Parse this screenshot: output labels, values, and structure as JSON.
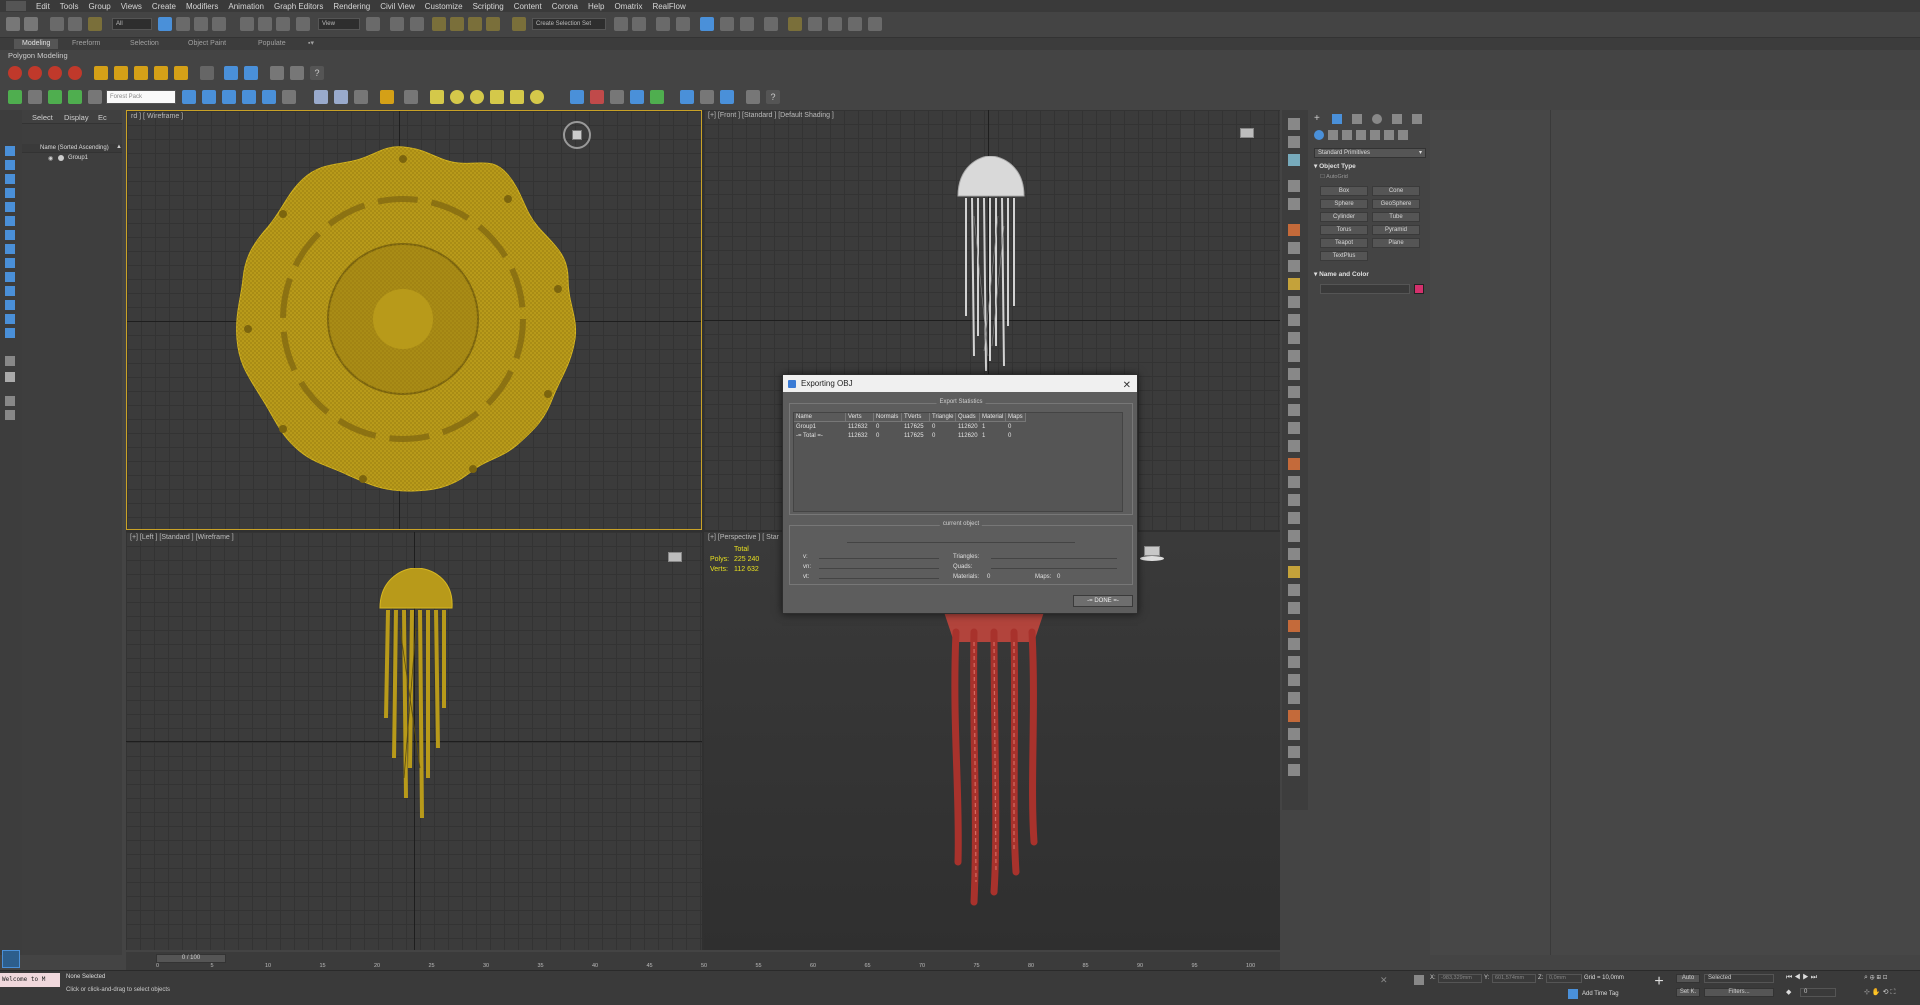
{
  "menu": [
    "Edit",
    "Tools",
    "Group",
    "Views",
    "Create",
    "Modifiers",
    "Animation",
    "Graph Editors",
    "Rendering",
    "Civil View",
    "Customize",
    "Scripting",
    "Content",
    "Corona",
    "Help",
    "Omatrix",
    "RealFlow"
  ],
  "toolbar": {
    "selection_filter": "All",
    "view_mode": "View",
    "create_selection_set": "Create Selection Set"
  },
  "ribbon": {
    "tabs": [
      "Modeling",
      "Freeform",
      "Selection",
      "Object Paint",
      "Populate"
    ],
    "active_tab": "Modeling",
    "label": "Polygon Modeling",
    "forest_pack": "Forest Pack"
  },
  "scene_explorer": {
    "tabs": [
      "Select",
      "Display",
      "Ec"
    ],
    "header": "Name (Sorted Ascending)",
    "items": [
      "Group1"
    ]
  },
  "viewports": {
    "top": {
      "label": "rd ] [ Wireframe ]"
    },
    "front": {
      "label": "[+] [Front ] [Standard ] [Default Shading ]"
    },
    "left": {
      "label": "[+] [Left ] [Standard ] [Wireframe ]"
    },
    "perspective": {
      "label": "[+] [Perspective ] [ Star",
      "stats": {
        "header": "Total",
        "polys_label": "Polys:",
        "polys": "225 240",
        "verts_label": "Verts:",
        "verts": "112 632"
      }
    }
  },
  "command_panel": {
    "dropdown": "Standard Primitives",
    "rollout_object_type": "Object Type",
    "autogrid": "AutoGrid",
    "buttons": [
      "Box",
      "Cone",
      "Sphere",
      "GeoSphere",
      "Cylinder",
      "Tube",
      "Torus",
      "Pyramid",
      "Teapot",
      "Plane",
      "TextPlus"
    ],
    "rollout_name_color": "Name and Color",
    "object_color": "#d4306c"
  },
  "dialog": {
    "title": "Exporting OBJ",
    "group_export": "Export Statistics",
    "columns": [
      "Name",
      "Verts",
      "Normals",
      "TVerts",
      "Triangle",
      "Quads",
      "Material",
      "Maps"
    ],
    "rows": [
      [
        "Group1",
        "112632",
        "0",
        "117625",
        "0",
        "112620",
        "1",
        "0"
      ],
      [
        "-= Total =-",
        "112632",
        "0",
        "117625",
        "0",
        "112620",
        "1",
        "0"
      ]
    ],
    "group_current": "current object",
    "fields_left": [
      "v:",
      "vn:",
      "vt:"
    ],
    "fields_right": [
      "Triangles:",
      "Quads:"
    ],
    "materials_label": "Materials:",
    "materials_value": "0",
    "maps_label": "Maps:",
    "maps_value": "0",
    "done": "-= DONE =-"
  },
  "timeline": {
    "frame": "0 / 100",
    "ticks": [
      "0",
      "5",
      "10",
      "15",
      "20",
      "25",
      "30",
      "35",
      "40",
      "45",
      "50",
      "55",
      "60",
      "65",
      "70",
      "75",
      "80",
      "85",
      "90",
      "95",
      "100"
    ]
  },
  "status": {
    "listener": "Welcome to M",
    "selection": "None Selected",
    "prompt": "Click or click-and-drag to select objects",
    "x_label": "X:",
    "x_value": "-983,329mm",
    "y_label": "Y:",
    "y_value": "601,574mm",
    "z_label": "Z:",
    "z_value": "0,0mm",
    "grid": "Grid = 10,0mm",
    "add_time_tag": "Add Time Tag",
    "auto": "Auto",
    "selected": "Selected",
    "set_k": "Set K.",
    "filters": "Filters...",
    "frame": "0"
  },
  "colors": {
    "wireframe": "#b89a1a",
    "jellyfish_front": "#d9d9d9",
    "jellyfish_persp": "#a8322c",
    "accent_blue": "#4a90d9"
  }
}
